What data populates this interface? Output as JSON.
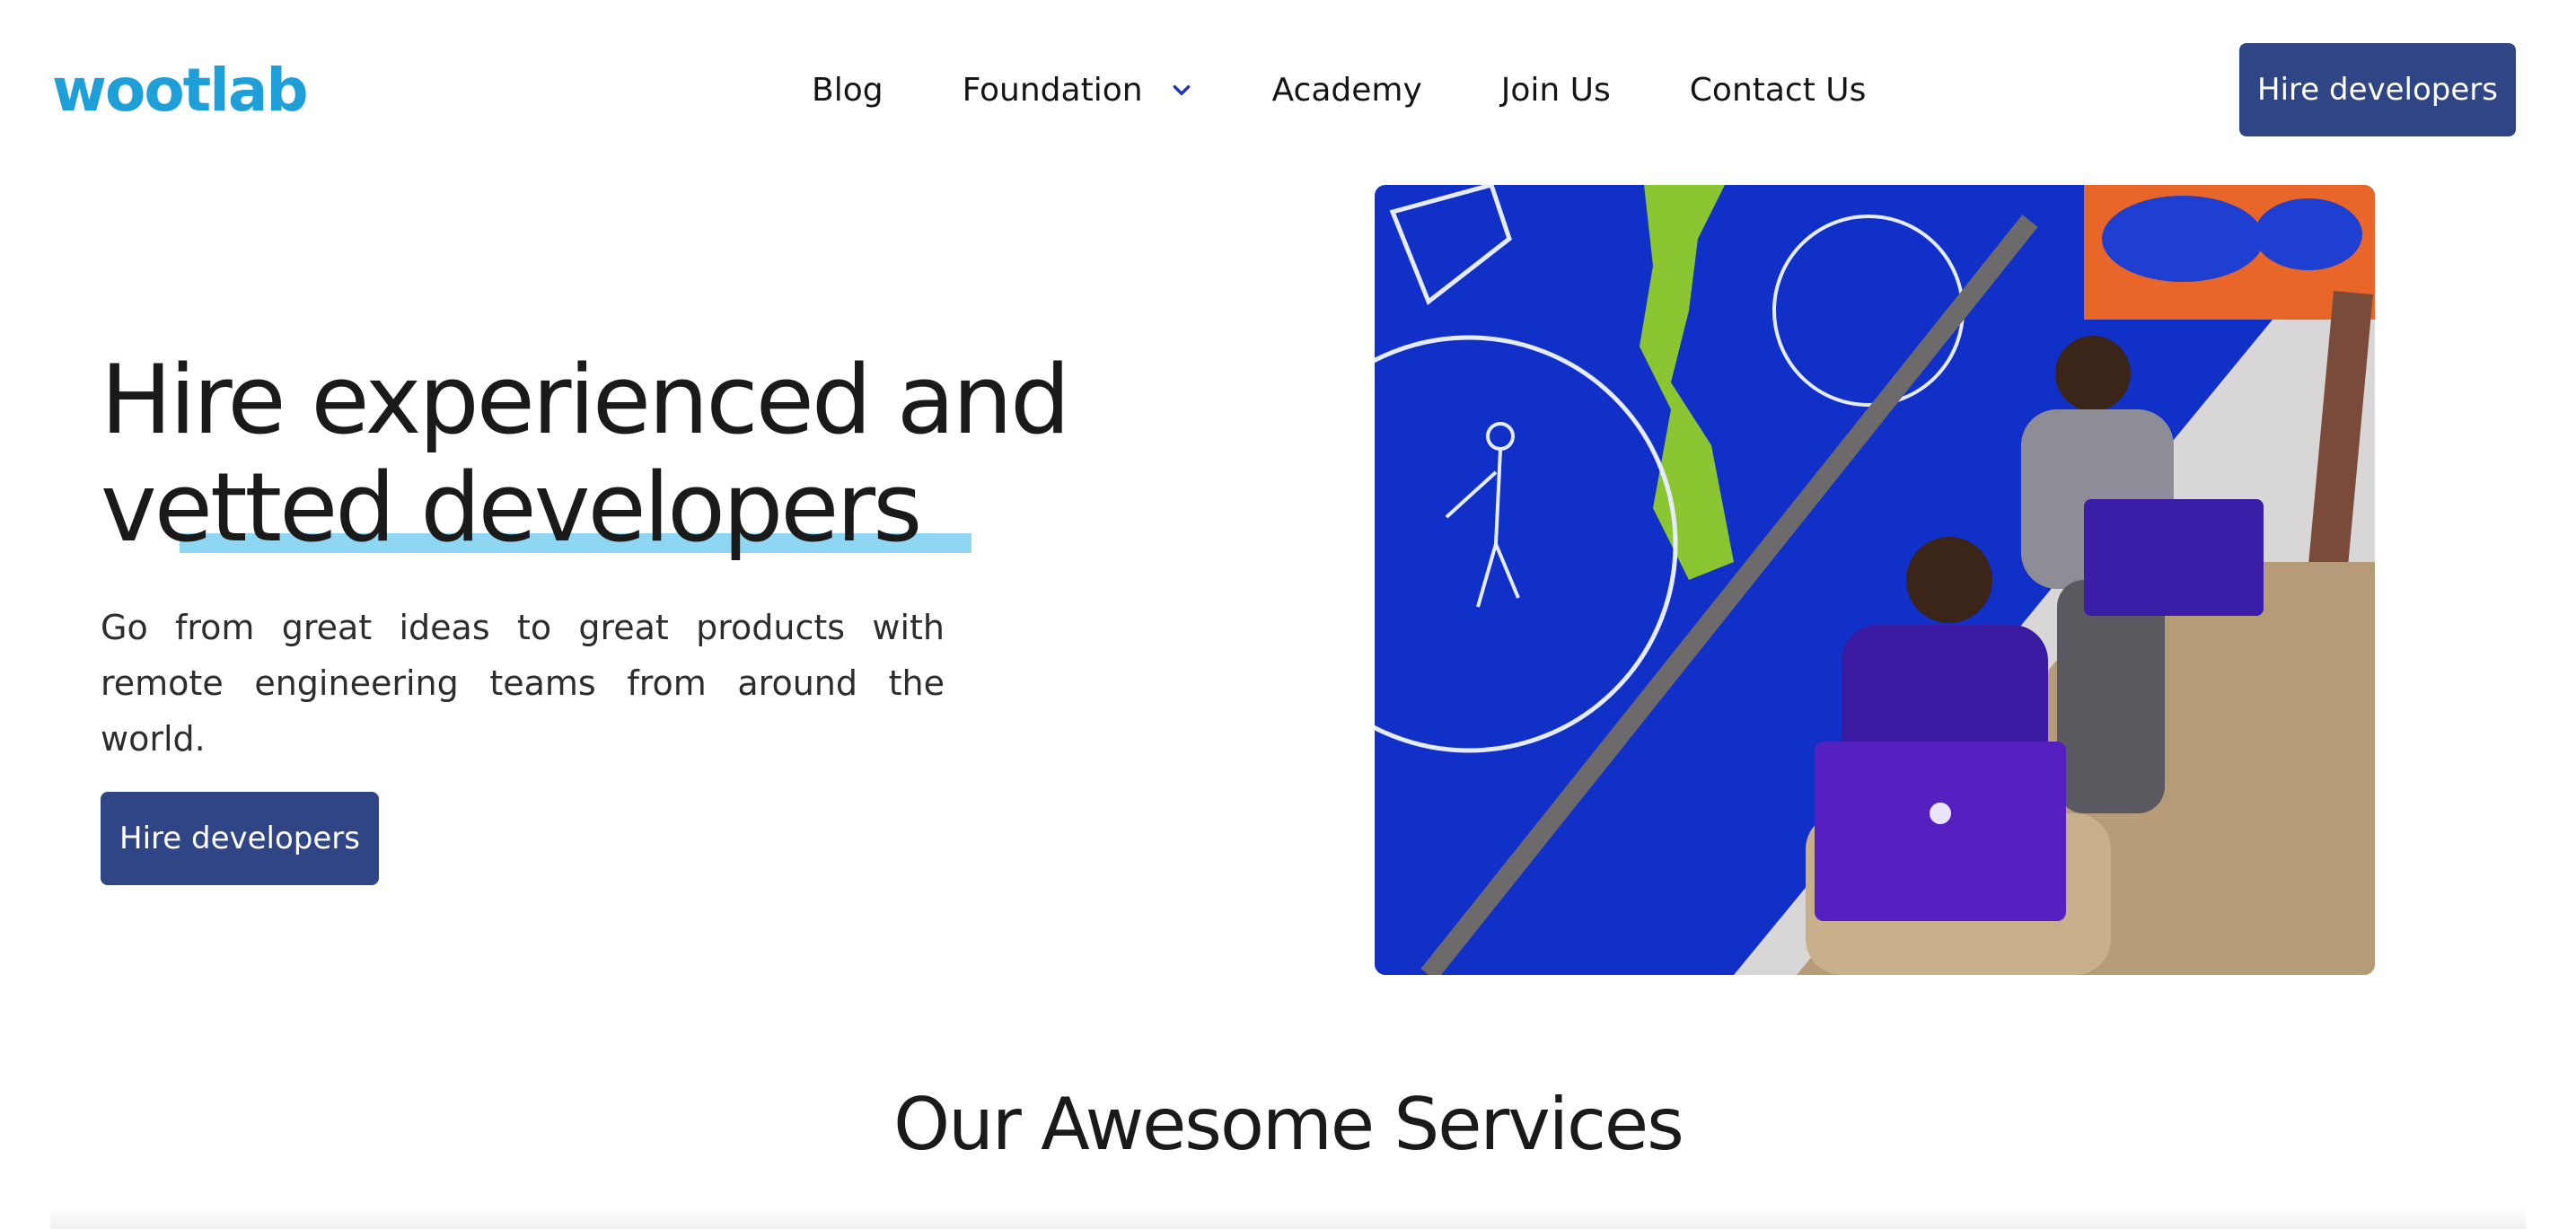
{
  "header": {
    "logo_text": "wootlab",
    "nav": [
      {
        "label": "Blog"
      },
      {
        "label": "Foundation",
        "has_dropdown": true,
        "icon": "chevron-down-icon"
      },
      {
        "label": "Academy"
      },
      {
        "label": "Join Us"
      },
      {
        "label": "Contact Us"
      }
    ],
    "cta_label": "Hire developers"
  },
  "hero": {
    "title_line1": "Hire experienced and",
    "title_line2": "vetted developers",
    "subtitle": "Go from great ideas to great products with remote engineering teams from around the world.",
    "cta_label": "Hire developers",
    "image_alt": "Two developers working on purple laptops on a staircase beside a blue chalk-drawn mural"
  },
  "services": {
    "title": "Our Awesome Services"
  },
  "colors": {
    "brand_blue": "#1e9fd8",
    "button_navy": "#2f4585",
    "highlight": "#8fd6f2",
    "chevron": "#2036b8"
  }
}
